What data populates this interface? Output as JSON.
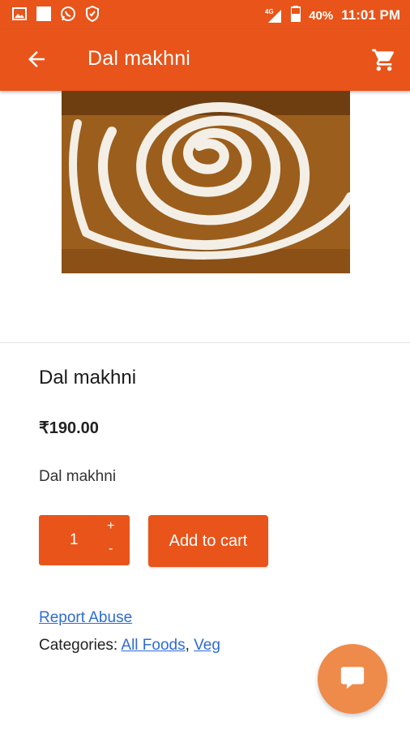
{
  "status_bar": {
    "network": "4G",
    "battery": "40%",
    "time": "11:01 PM"
  },
  "app_bar": {
    "title": "Dal makhni"
  },
  "product": {
    "title": "Dal makhni",
    "price": "₹190.00",
    "description": "Dal makhni"
  },
  "quantity": {
    "value": "1",
    "plus": "+",
    "minus": "-"
  },
  "add_to_cart_label": "Add to cart",
  "links": {
    "report_abuse": "Report Abuse",
    "categories_label": "Categories: ",
    "category_1": "All Foods",
    "separator": ", ",
    "category_2": "Veg"
  },
  "colors": {
    "primary": "#e8541a",
    "fab": "#ee8a4a",
    "link": "#2e6bd6"
  }
}
